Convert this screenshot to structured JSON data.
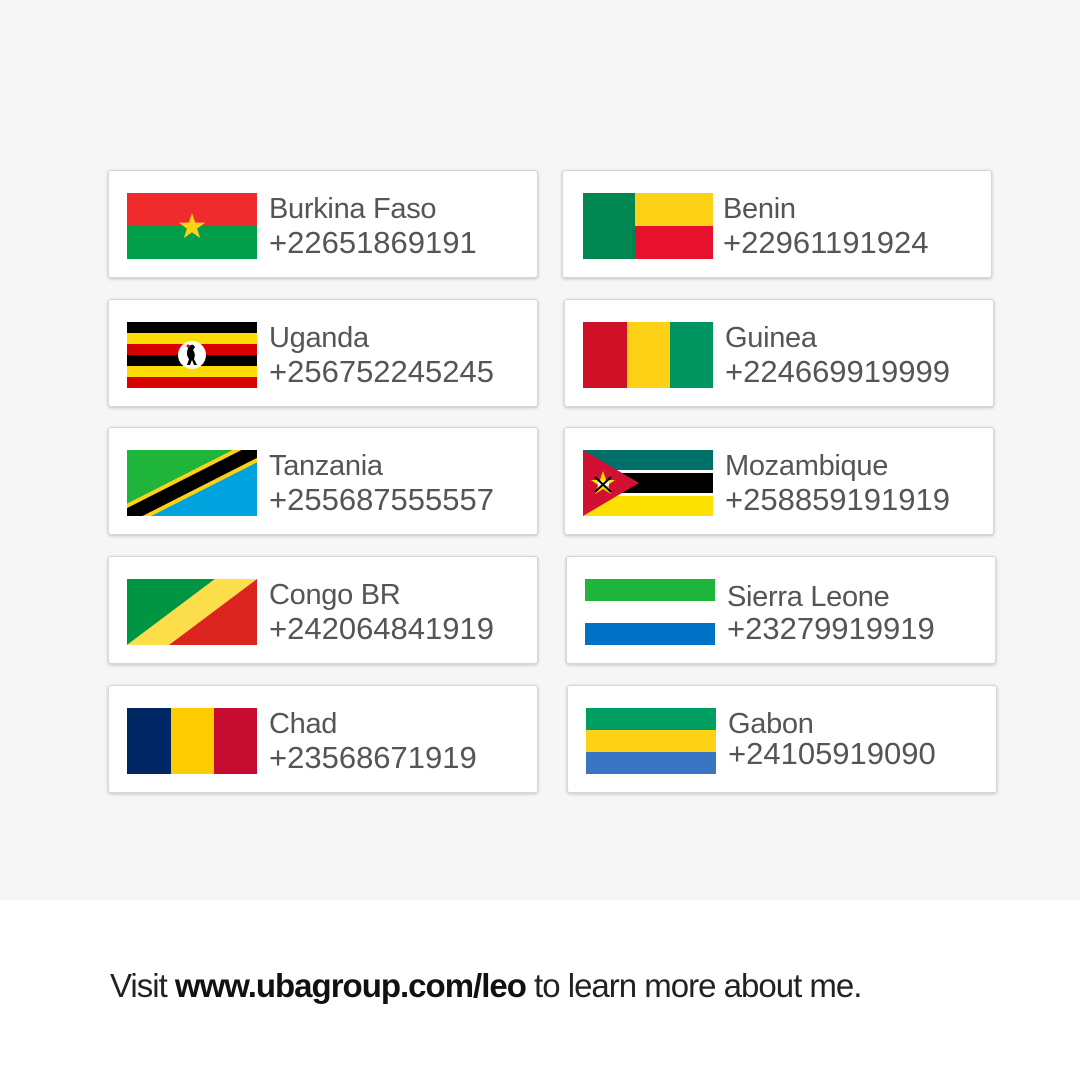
{
  "countries": [
    {
      "name": "Burkina Faso",
      "phone": "+22651869191",
      "flag_icon": "burkina-faso-flag-icon"
    },
    {
      "name": "Benin",
      "phone": "+22961191924",
      "flag_icon": "benin-flag-icon"
    },
    {
      "name": "Uganda",
      "phone": "+256752245245",
      "flag_icon": "uganda-flag-icon"
    },
    {
      "name": "Guinea",
      "phone": "+224669919999",
      "flag_icon": "guinea-flag-icon"
    },
    {
      "name": "Tanzania",
      "phone": "+255687555557",
      "flag_icon": "tanzania-flag-icon"
    },
    {
      "name": "Mozambique",
      "phone": "+258859191919",
      "flag_icon": "mozambique-flag-icon"
    },
    {
      "name": "Congo BR",
      "phone": "+242064841919",
      "flag_icon": "congo-br-flag-icon"
    },
    {
      "name": "Sierra Leone",
      "phone": "+23279919919",
      "flag_icon": "sierra-leone-flag-icon"
    },
    {
      "name": "Chad",
      "phone": "+23568671919",
      "flag_icon": "chad-flag-icon"
    },
    {
      "name": "Gabon",
      "phone": "+24105919090",
      "flag_icon": "gabon-flag-icon"
    }
  ],
  "footer": {
    "prefix": "Visit ",
    "link": "www.ubagroup.com/leo",
    "suffix": " to learn more about me."
  },
  "colors": {
    "page_background": "#f6f6f6",
    "card_background": "#ffffff",
    "card_text": "#555555",
    "footer_text": "#222222"
  }
}
